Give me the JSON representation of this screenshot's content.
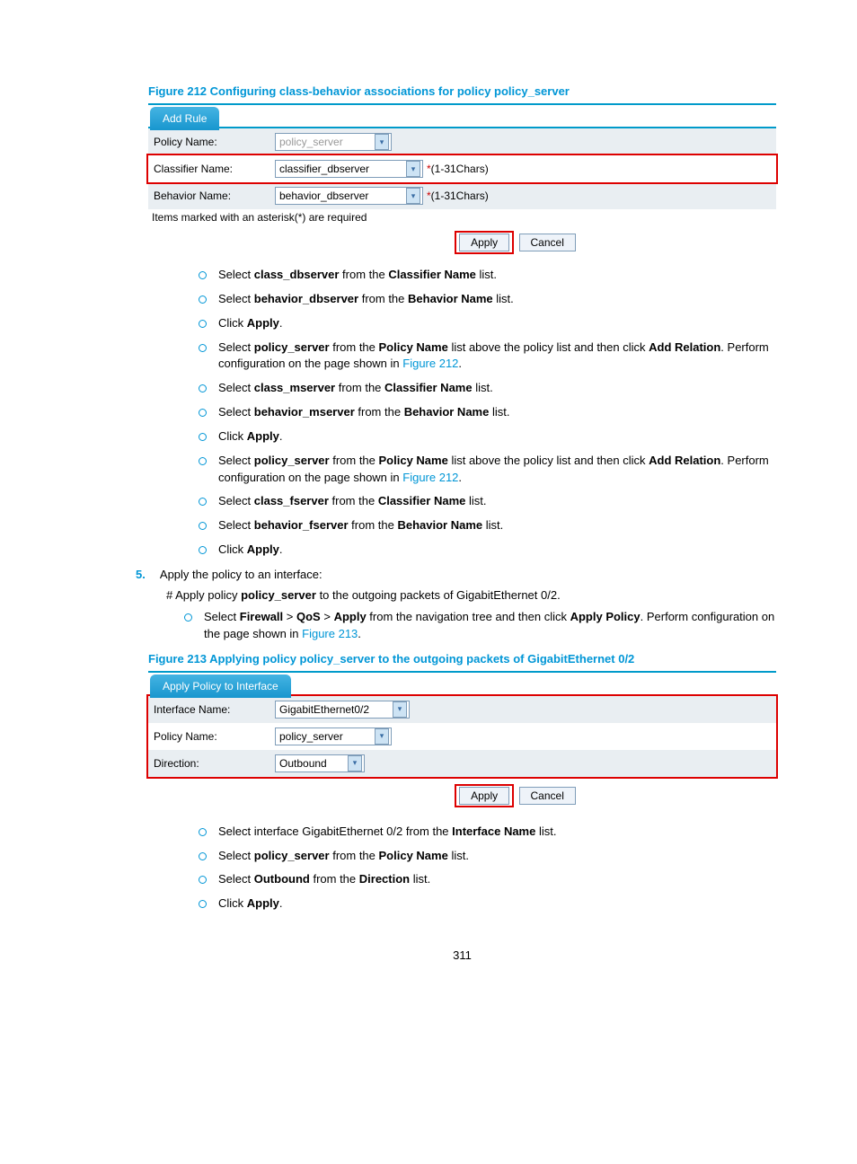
{
  "figure212": {
    "caption": "Figure 212 Configuring class-behavior associations for policy policy_server",
    "tab": "Add Rule",
    "policy_label": "Policy Name:",
    "policy_value": "policy_server",
    "classifier_label": "Classifier Name:",
    "classifier_value": "classifier_dbserver",
    "behavior_label": "Behavior Name:",
    "behavior_value": "behavior_dbserver",
    "chars_hint": "(1-31Chars)",
    "note": "Items marked with an asterisk(*) are required",
    "apply": "Apply",
    "cancel": "Cancel"
  },
  "list1": {
    "i1_a": "Select ",
    "i1_b": "class_dbserver",
    "i1_c": " from the ",
    "i1_d": "Classifier Name",
    "i1_e": " list.",
    "i2_a": "Select ",
    "i2_b": "behavior_dbserver",
    "i2_c": " from the ",
    "i2_d": "Behavior Name",
    "i2_e": " list.",
    "i3_a": "Click ",
    "i3_b": "Apply",
    "i3_c": ".",
    "i4_a": "Select ",
    "i4_b": "policy_server",
    "i4_c": " from the ",
    "i4_d": "Policy Name",
    "i4_e": " list above the policy list and then click ",
    "i4_f": "Add Relation",
    "i4_g": ". Perform configuration on the page shown in ",
    "i4_h": "Figure 212",
    "i4_i": ".",
    "i5_a": "Select ",
    "i5_b": "class_mserver",
    "i5_c": " from the ",
    "i5_d": "Classifier Name",
    "i5_e": " list.",
    "i6_a": "Select ",
    "i6_b": "behavior_mserver",
    "i6_c": " from the ",
    "i6_d": "Behavior Name",
    "i6_e": " list.",
    "i7_a": "Click ",
    "i7_b": "Apply",
    "i7_c": ".",
    "i8_a": "Select ",
    "i8_b": "policy_server",
    "i8_c": " from the ",
    "i8_d": "Policy Name",
    "i8_e": " list above the policy list and then click ",
    "i8_f": "Add Relation",
    "i8_g": ". Perform configuration on the page shown in ",
    "i8_h": "Figure 212",
    "i8_i": ".",
    "i9_a": "Select ",
    "i9_b": "class_fserver",
    "i9_c": " from the ",
    "i9_d": "Classifier Name",
    "i9_e": " list.",
    "i10_a": "Select ",
    "i10_b": "behavior_fserver",
    "i10_c": " from the ",
    "i10_d": "Behavior Name",
    "i10_e": " list.",
    "i11_a": "Click ",
    "i11_b": "Apply",
    "i11_c": "."
  },
  "step5": {
    "num": "5.",
    "text": "Apply the policy to an interface:",
    "hash_a": "# Apply policy ",
    "hash_b": "policy_server",
    "hash_c": " to the outgoing packets of GigabitEthernet 0/2.",
    "s1_a": "Select ",
    "s1_b": "Firewall",
    "s1_c": " > ",
    "s1_d": "QoS",
    "s1_e": " > ",
    "s1_f": "Apply",
    "s1_g": " from the navigation tree and then click ",
    "s1_h": "Apply Policy",
    "s1_i": ". Perform configuration on the page shown in ",
    "s1_j": "Figure 213",
    "s1_k": "."
  },
  "figure213": {
    "caption": "Figure 213 Applying policy policy_server to the outgoing packets of GigabitEthernet 0/2",
    "tab": "Apply Policy to Interface",
    "iface_label": "Interface Name:",
    "iface_value": "GigabitEthernet0/2",
    "policy_label": "Policy Name:",
    "policy_value": "policy_server",
    "dir_label": "Direction:",
    "dir_value": "Outbound",
    "apply": "Apply",
    "cancel": "Cancel"
  },
  "list2": {
    "i1_a": "Select interface GigabitEthernet 0/2 from the ",
    "i1_b": "Interface Name",
    "i1_c": " list.",
    "i2_a": "Select ",
    "i2_b": "policy_server",
    "i2_c": " from the ",
    "i2_d": "Policy Name",
    "i2_e": " list.",
    "i3_a": "Select ",
    "i3_b": "Outbound",
    "i3_c": " from the ",
    "i3_d": "Direction",
    "i3_e": " list.",
    "i4_a": "Click ",
    "i4_b": "Apply",
    "i4_c": "."
  },
  "pagenum": "311"
}
